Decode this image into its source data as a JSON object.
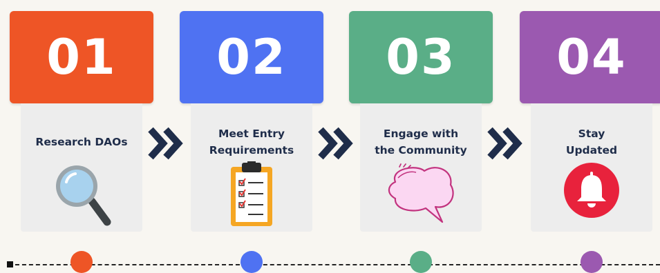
{
  "steps": [
    {
      "number": "01",
      "title": "Research DAOs",
      "icon": "magnifier-icon",
      "color": "#ee5526"
    },
    {
      "number": "02",
      "title": "Meet Entry\nRequirements",
      "icon": "clipboard-checklist-icon",
      "color": "#4f72f2"
    },
    {
      "number": "03",
      "title": "Engage with\nthe Community",
      "icon": "speech-bubble-icon",
      "color": "#5aae87"
    },
    {
      "number": "04",
      "title": "Stay\nUpdated",
      "icon": "bell-icon",
      "color": "#9b59b0"
    }
  ],
  "colors": {
    "background": "#f8f6f1",
    "card": "#ededed",
    "text": "#1f2d4a",
    "chevron": "#1f2d4a"
  }
}
